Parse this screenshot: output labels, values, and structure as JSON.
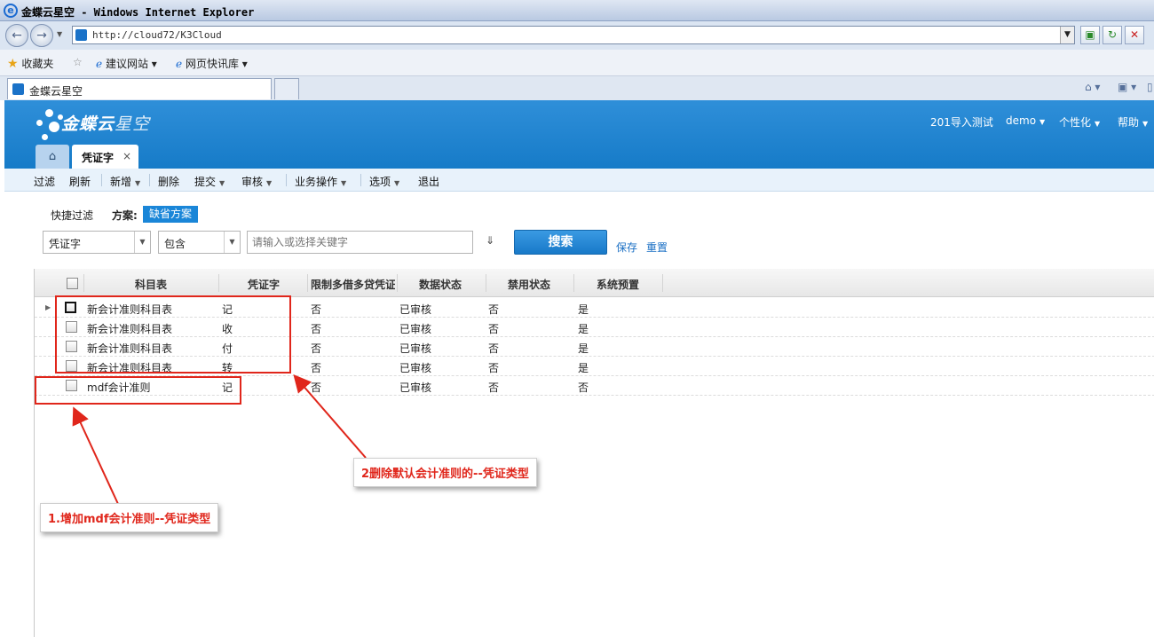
{
  "browser": {
    "window_title": "金蝶云星空 - Windows Internet Explorer",
    "url": "http://cloud72/K3Cloud",
    "favorites_label": "收藏夹",
    "fav_items": [
      "建议网站 ▾",
      "网页快讯库 ▾"
    ],
    "tab_title": "金蝶云星空"
  },
  "app": {
    "logo_main": "金蝶云",
    "logo_sub": "星空",
    "header_links": [
      "201导入测试",
      "demo",
      "个性化",
      "帮助"
    ],
    "page_tab": "凭证字",
    "page_tab_close": "×"
  },
  "toolbar": {
    "items": [
      "过滤",
      "刷新",
      "新增",
      "删除",
      "提交",
      "审核",
      "业务操作",
      "选项",
      "退出"
    ]
  },
  "filter": {
    "quick_filter_label": "快捷过滤",
    "scheme_label": "方案:",
    "scheme_value": "缺省方案",
    "field_value": "凭证字",
    "operator_value": "包含",
    "keyword_placeholder": "请输入或选择关键字",
    "search_label": "搜索",
    "save_label": "保存",
    "reset_label": "重置"
  },
  "grid": {
    "columns": [
      "科目表",
      "凭证字",
      "限制多借多贷凭证",
      "数据状态",
      "禁用状态",
      "系统预置"
    ],
    "rows": [
      {
        "account_table": "新会计准则科目表",
        "voucher_word": "记",
        "limit": "否",
        "data_status": "已审核",
        "disabled": "否",
        "preset": "是"
      },
      {
        "account_table": "新会计准则科目表",
        "voucher_word": "收",
        "limit": "否",
        "data_status": "已审核",
        "disabled": "否",
        "preset": "是"
      },
      {
        "account_table": "新会计准则科目表",
        "voucher_word": "付",
        "limit": "否",
        "data_status": "已审核",
        "disabled": "否",
        "preset": "是"
      },
      {
        "account_table": "新会计准则科目表",
        "voucher_word": "转",
        "limit": "否",
        "data_status": "已审核",
        "disabled": "否",
        "preset": "是"
      },
      {
        "account_table": "mdf会计准则",
        "voucher_word": "记",
        "limit": "否",
        "data_status": "已审核",
        "disabled": "否",
        "preset": "否"
      }
    ]
  },
  "annotations": {
    "note1": "1.增加mdf会计准则--凭证类型",
    "note2": "2删除默认会计准则的--凭证类型"
  },
  "colors": {
    "header_blue": "#1a82d0",
    "annotation_red": "#e0261b",
    "search_blue": "#1879c8"
  }
}
